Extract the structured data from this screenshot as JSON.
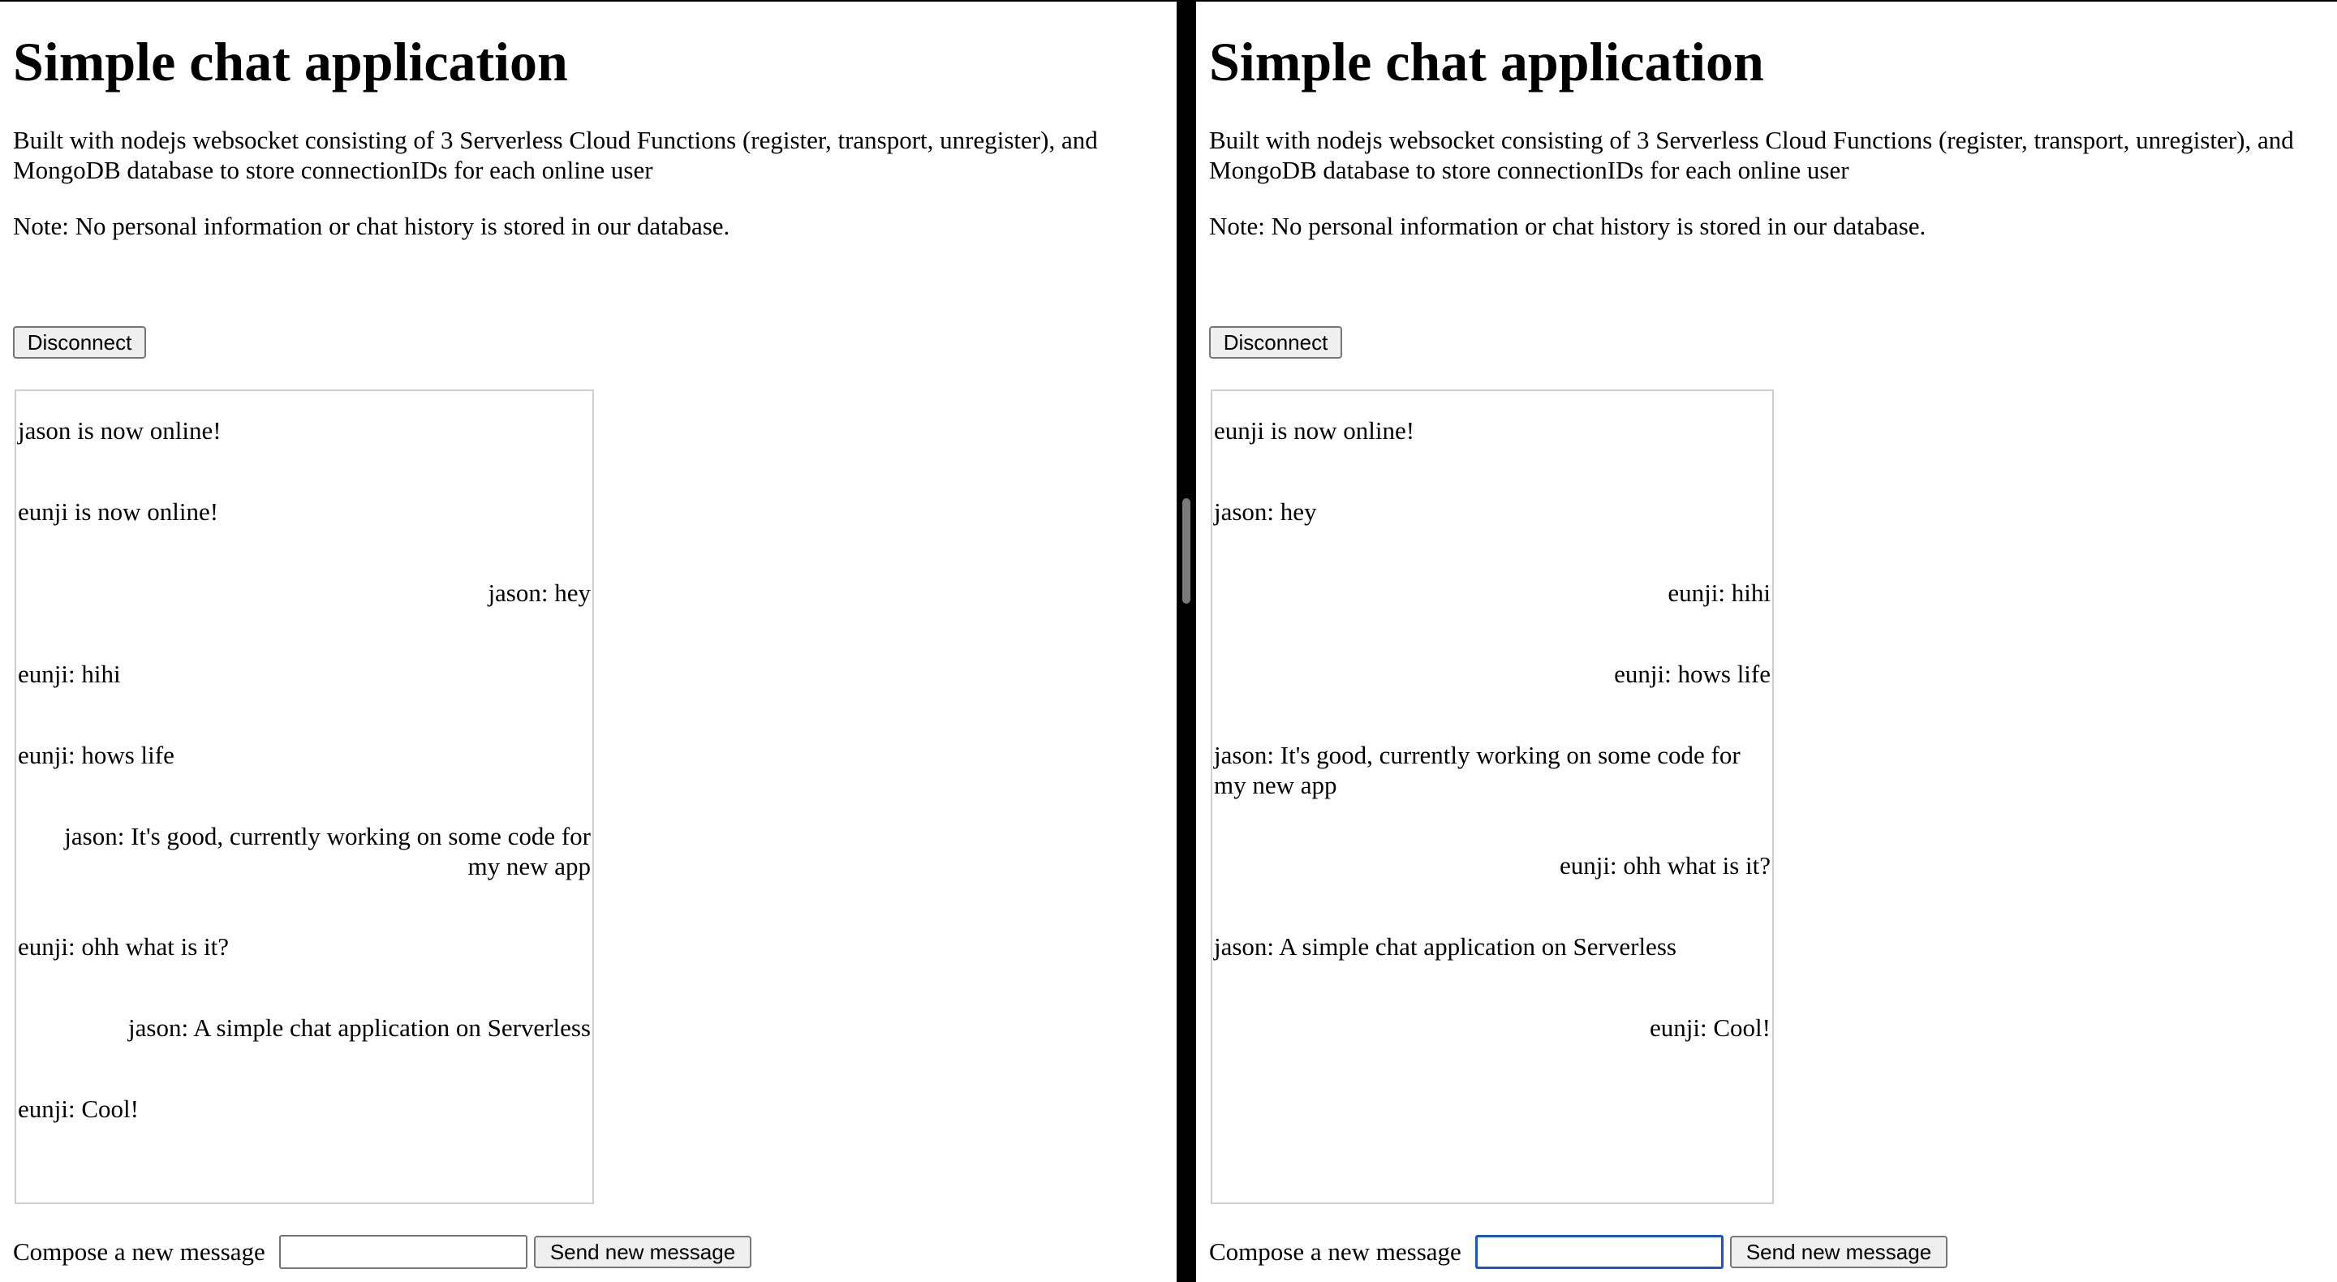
{
  "panes": [
    {
      "title": "Simple chat application",
      "description": "Built with nodejs websocket consisting of 3 Serverless Cloud Functions (register, transport, unregister), and MongoDB database to store connectionIDs for each online user",
      "note": "Note: No personal information or chat history is stored in our database.",
      "disconnect_label": "Disconnect",
      "messages": [
        {
          "text": "jason is now online!",
          "align": "left"
        },
        {
          "text": "eunji is now online!",
          "align": "left"
        },
        {
          "text": "jason: hey",
          "align": "right"
        },
        {
          "text": "eunji: hihi",
          "align": "left"
        },
        {
          "text": "eunji: hows life",
          "align": "left"
        },
        {
          "text": "jason: It's good, currently working on some code for my new app",
          "align": "right"
        },
        {
          "text": "eunji: ohh what is it?",
          "align": "left"
        },
        {
          "text": "jason: A simple chat application on Serverless",
          "align": "right"
        },
        {
          "text": "eunji: Cool!",
          "align": "left"
        }
      ],
      "compose_label": "Compose a new message",
      "compose_value": "",
      "send_label": "Send new message"
    },
    {
      "title": "Simple chat application",
      "description": "Built with nodejs websocket consisting of 3 Serverless Cloud Functions (register, transport, unregister), and MongoDB database to store connectionIDs for each online user",
      "note": "Note: No personal information or chat history is stored in our database.",
      "disconnect_label": "Disconnect",
      "messages": [
        {
          "text": "eunji is now online!",
          "align": "left"
        },
        {
          "text": "jason: hey",
          "align": "left"
        },
        {
          "text": "eunji: hihi",
          "align": "right"
        },
        {
          "text": "eunji: hows life",
          "align": "right"
        },
        {
          "text": "jason: It's good, currently working on some code for my new app",
          "align": "left"
        },
        {
          "text": "eunji: ohh what is it?",
          "align": "right"
        },
        {
          "text": "jason: A simple chat application on Serverless",
          "align": "left"
        },
        {
          "text": "eunji: Cool!",
          "align": "right"
        }
      ],
      "compose_label": "Compose a new message",
      "compose_value": "",
      "send_label": "Send new message"
    }
  ]
}
